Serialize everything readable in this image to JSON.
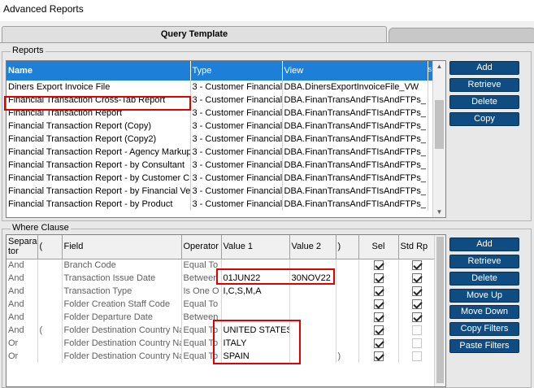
{
  "window": {
    "title": "Advanced Reports"
  },
  "tabs": [
    {
      "label": "Query Template"
    }
  ],
  "reports": {
    "group_label": "Reports",
    "columns": [
      "Name",
      "Type",
      "View",
      "S F"
    ],
    "rows": [
      {
        "name": "Diners Export Invoice File",
        "type": "3 - Customer Financial",
        "view": "DBA.DinersExportInvoiceFile_VW"
      },
      {
        "name": "Financial Transaction Cross-Tab Report",
        "type": "3 - Customer Financial",
        "view": "DBA.FinanTransAndFTIsAndFTPs_"
      },
      {
        "name": "Financial Transaction Report",
        "type": "3 - Customer Financial",
        "view": "DBA.FinanTransAndFTIsAndFTPs_"
      },
      {
        "name": "Financial Transaction Report (Copy)",
        "type": "3 - Customer Financial",
        "view": "DBA.FinanTransAndFTIsAndFTPs_"
      },
      {
        "name": "Financial Transaction Report (Copy2)",
        "type": "3 - Customer Financial",
        "view": "DBA.FinanTransAndFTIsAndFTPs_"
      },
      {
        "name": "Financial Transaction Report - Agency Markup",
        "type": "3 - Customer Financial",
        "view": "DBA.FinanTransAndFTIsAndFTPs_"
      },
      {
        "name": "Financial Transaction Report - by Consultant",
        "type": "3 - Customer Financial",
        "view": "DBA.FinanTransAndFTIsAndFTPs_"
      },
      {
        "name": "Financial Transaction Report - by Customer C",
        "type": "3 - Customer Financial",
        "view": "DBA.FinanTransAndFTIsAndFTPs_"
      },
      {
        "name": "Financial Transaction Report - by Financial Ve",
        "type": "3 - Customer Financial",
        "view": "DBA.FinanTransAndFTIsAndFTPs_"
      },
      {
        "name": "Financial Transaction Report - by Product",
        "type": "3 - Customer Financial",
        "view": "DBA.FinanTransAndFTIsAndFTPs_"
      }
    ],
    "buttons": [
      "Add",
      "Retrieve",
      "Delete",
      "Copy"
    ]
  },
  "where": {
    "group_label": "Where Clause",
    "columns": [
      "Separa tor",
      "(",
      "Field",
      "Operator",
      "Value 1",
      "Value 2",
      ")",
      "Sel",
      "Std Rp"
    ],
    "rows": [
      {
        "sep": "And",
        "lp": "",
        "field": "Branch Code",
        "op": "Equal To",
        "v1": "",
        "v2": "",
        "rp": "",
        "sel": true,
        "std": true
      },
      {
        "sep": "And",
        "lp": "",
        "field": "Transaction Issue Date",
        "op": "Between",
        "v1": "01JUN22",
        "v2": "30NOV22",
        "rp": "",
        "sel": true,
        "std": true
      },
      {
        "sep": "And",
        "lp": "",
        "field": "Transaction Type",
        "op": "Is One O",
        "v1": "I,C,S,M,A",
        "v2": "",
        "rp": "",
        "sel": true,
        "std": true
      },
      {
        "sep": "And",
        "lp": "",
        "field": "Folder Creation Staff Code",
        "op": "Equal To",
        "v1": "",
        "v2": "",
        "rp": "",
        "sel": true,
        "std": true
      },
      {
        "sep": "And",
        "lp": "",
        "field": "Folder Departure Date",
        "op": "Between",
        "v1": "",
        "v2": "",
        "rp": "",
        "sel": true,
        "std": true
      },
      {
        "sep": "And",
        "lp": "(",
        "field": "Folder Destination Country Na",
        "op": "Equal To",
        "v1": "UNITED STATES",
        "v2": "",
        "rp": "",
        "sel": true,
        "std": false
      },
      {
        "sep": "Or",
        "lp": "",
        "field": "Folder Destination Country Na",
        "op": "Equal To",
        "v1": "ITALY",
        "v2": "",
        "rp": "",
        "sel": true,
        "std": false
      },
      {
        "sep": "Or",
        "lp": "",
        "field": "Folder Destination Country Na",
        "op": "Equal To",
        "v1": "SPAIN",
        "v2": "",
        "rp": ")",
        "sel": true,
        "std": false
      }
    ],
    "buttons": [
      "Add",
      "Retrieve",
      "Delete",
      "Move Up",
      "Move Down",
      "Copy Filters",
      "Paste Filters"
    ]
  },
  "colors": {
    "header_blue": "#1e7fd8",
    "button_navy": "#0f4c81",
    "highlight_red": "#e00000"
  }
}
